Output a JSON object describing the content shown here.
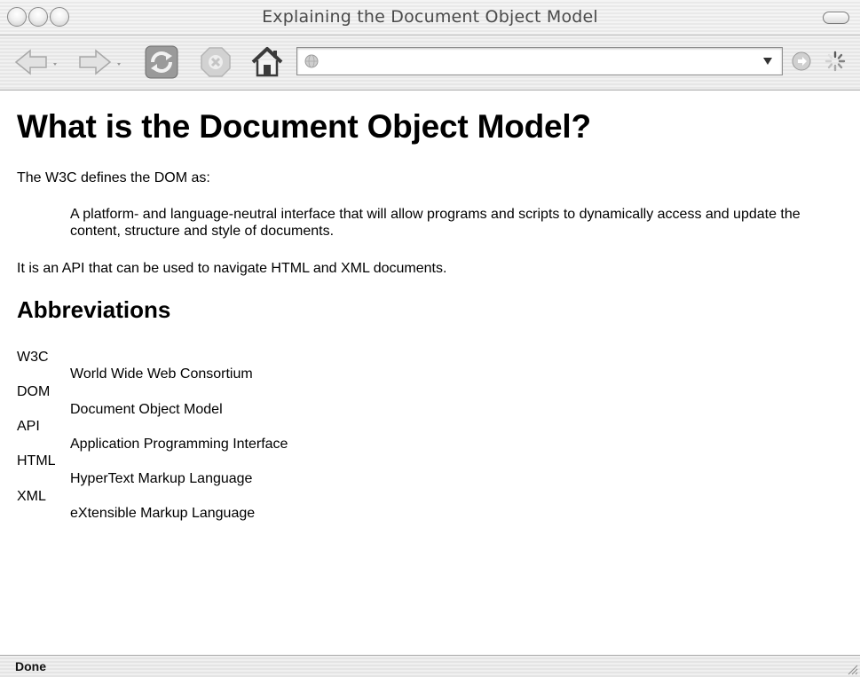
{
  "window": {
    "title": "Explaining the Document Object Model"
  },
  "toolbar": {
    "address_value": ""
  },
  "page": {
    "heading": "What is the Document Object Model?",
    "intro": "The W3C defines the DOM as:",
    "quote": "A platform- and language-neutral interface that will allow programs and scripts to dynamically access and update the content, structure and style of documents.",
    "api_text": "It is an API that can be used to navigate HTML and XML documents.",
    "abbr_heading": "Abbreviations",
    "abbreviations": [
      {
        "term": "W3C",
        "definition": "World Wide Web Consortium"
      },
      {
        "term": "DOM",
        "definition": "Document Object Model"
      },
      {
        "term": "API",
        "definition": "Application Programming Interface"
      },
      {
        "term": "HTML",
        "definition": "HyperText Markup Language"
      },
      {
        "term": "XML",
        "definition": "eXtensible Markup Language"
      }
    ]
  },
  "status": {
    "text": "Done"
  },
  "icons": {
    "back": "back-arrow-icon",
    "forward": "forward-arrow-icon",
    "reload": "reload-icon",
    "stop": "stop-icon",
    "home": "home-icon",
    "favicon": "globe-icon",
    "dropdown": "dropdown-arrow-icon",
    "go": "go-icon",
    "throbber": "loading-throbber-icon",
    "resize": "resize-grip-icon"
  }
}
